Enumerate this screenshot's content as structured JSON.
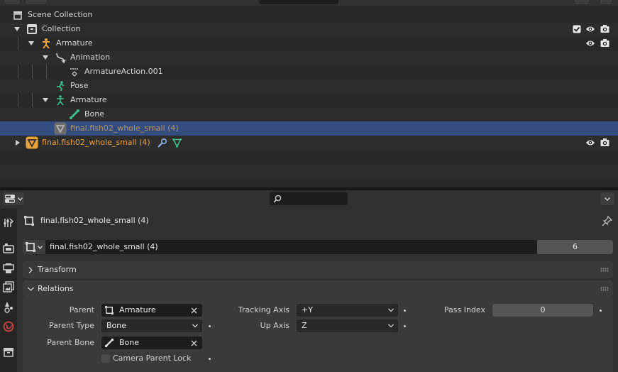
{
  "outliner": {
    "scene_collection": "Scene Collection",
    "collection": "Collection",
    "armature_obj": "Armature",
    "animation": "Animation",
    "action": "ArmatureAction.001",
    "pose": "Pose",
    "armature_data": "Armature",
    "bone": "Bone",
    "mesh_child": "final.fish02_whole_small (4)",
    "mesh_root": "final.fish02_whole_small (4)"
  },
  "properties": {
    "object_name": "final.fish02_whole_small (4)",
    "datablock_name": "final.fish02_whole_small (4)",
    "users_count": "6",
    "transform_panel": "Transform",
    "relations_panel": "Relations",
    "parent_label": "Parent",
    "parent_value": "Armature",
    "parent_type_label": "Parent Type",
    "parent_type_value": "Bone",
    "parent_bone_label": "Parent Bone",
    "parent_bone_value": "Bone",
    "camera_parent_lock": "Camera Parent Lock",
    "tracking_axis_label": "Tracking Axis",
    "tracking_axis_value": "+Y",
    "up_axis_label": "Up Axis",
    "up_axis_value": "Z",
    "pass_index_label": "Pass Index",
    "pass_index_value": "0"
  },
  "colors": {
    "selection": "#334d80",
    "object_orange": "#e8a33d",
    "data_green": "#3fbf8f",
    "panel_bg": "#303030"
  }
}
